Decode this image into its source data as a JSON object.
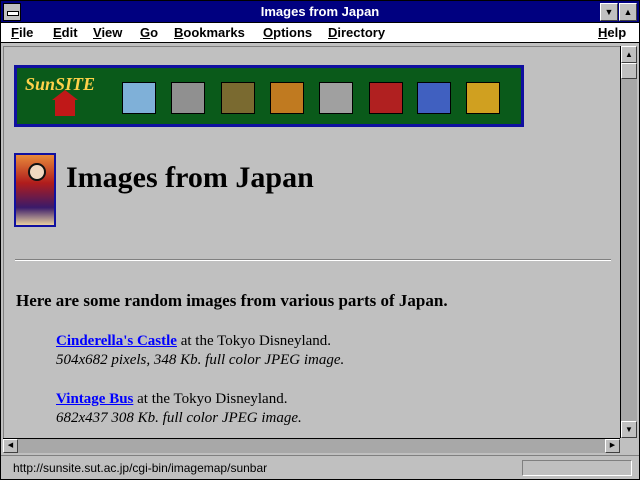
{
  "window": {
    "title": "Images from Japan"
  },
  "menubar": {
    "items": [
      {
        "label": "File",
        "accel": "F",
        "rest": "ile"
      },
      {
        "label": "Edit",
        "accel": "E",
        "rest": "dit"
      },
      {
        "label": "View",
        "accel": "V",
        "rest": "iew"
      },
      {
        "label": "Go",
        "accel": "G",
        "rest": "o"
      },
      {
        "label": "Bookmarks",
        "accel": "B",
        "rest": "ookmarks"
      },
      {
        "label": "Options",
        "accel": "O",
        "rest": "ptions"
      },
      {
        "label": "Directory",
        "accel": "D",
        "rest": "irectory"
      },
      {
        "label": "Help",
        "accel": "H",
        "rest": "elp"
      }
    ]
  },
  "banner": {
    "logo_text": "SunSITE",
    "icons": [
      {
        "name": "world-map-icon",
        "color": "#7fb0d8"
      },
      {
        "name": "computer-icon",
        "color": "#909090"
      },
      {
        "name": "mona-lisa-icon",
        "color": "#7a6a30"
      },
      {
        "name": "basket-icon",
        "color": "#c07a20"
      },
      {
        "name": "library-icon",
        "color": "#a0a0a0"
      },
      {
        "name": "hands-icon",
        "color": "#b02020"
      },
      {
        "name": "sun-logo-icon",
        "color": "#4060c0"
      },
      {
        "name": "film-icon",
        "color": "#d0a020"
      }
    ]
  },
  "page": {
    "heading": "Images from Japan",
    "intro": "Here are some random images from various parts of Japan.",
    "entries": [
      {
        "link": "Cinderella's Castle",
        "suffix": " at the Tokyo Disneyland.",
        "desc": "504x682 pixels, 348 Kb. full color JPEG image."
      },
      {
        "link": "Vintage Bus",
        "suffix": " at the Tokyo Disneyland.",
        "desc": "682x437 308 Kb. full color JPEG image."
      }
    ]
  },
  "status": {
    "url": "http://sunsite.sut.ac.jp/cgi-bin/imagemap/sunbar"
  }
}
